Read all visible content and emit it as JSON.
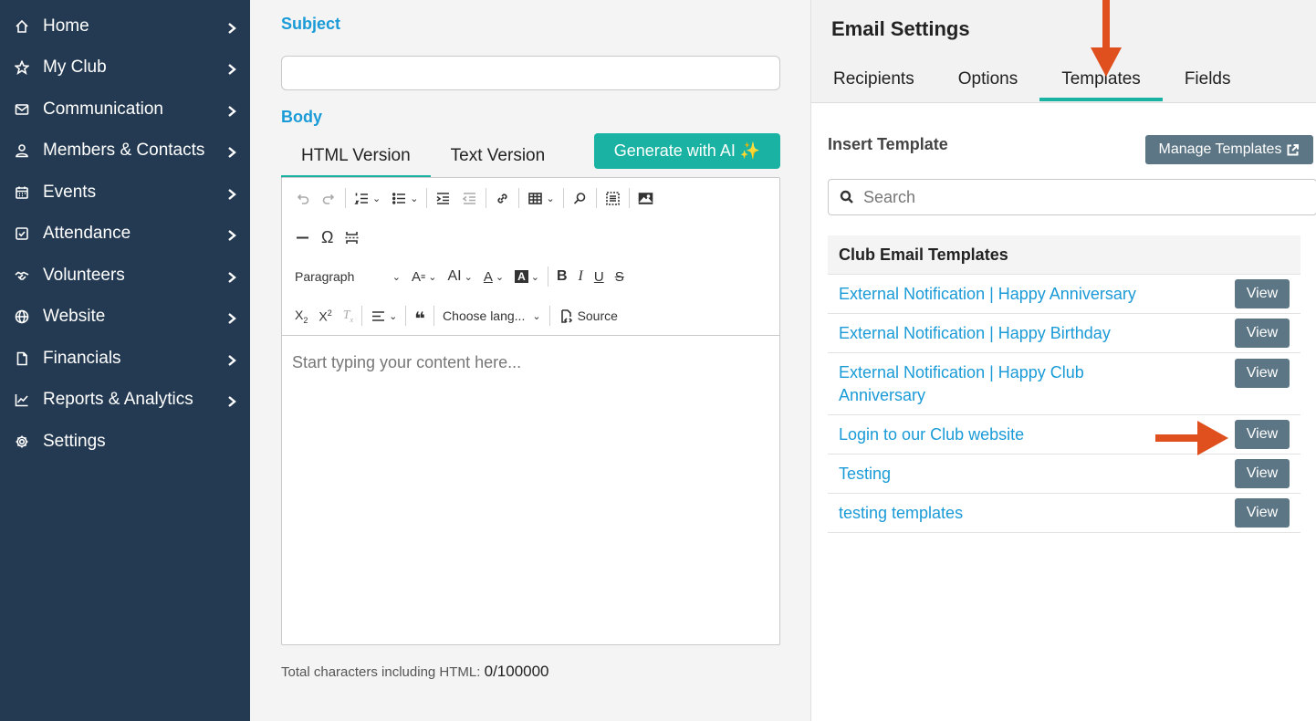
{
  "sidebar": {
    "items": [
      {
        "label": "Home",
        "icon": "home-icon"
      },
      {
        "label": "My Club",
        "icon": "star-icon"
      },
      {
        "label": "Communication",
        "icon": "mail-icon"
      },
      {
        "label": "Members & Contacts",
        "icon": "user-icon"
      },
      {
        "label": "Events",
        "icon": "calendar-icon"
      },
      {
        "label": "Attendance",
        "icon": "checkbox-icon"
      },
      {
        "label": "Volunteers",
        "icon": "handshake-icon"
      },
      {
        "label": "Website",
        "icon": "globe-icon"
      },
      {
        "label": "Financials",
        "icon": "document-icon"
      },
      {
        "label": "Reports & Analytics",
        "icon": "chart-icon"
      },
      {
        "label": "Settings",
        "icon": "gear-icon"
      }
    ]
  },
  "editor": {
    "subject_label": "Subject",
    "subject_value": "",
    "body_label": "Body",
    "tabs": [
      {
        "label": "HTML Version",
        "active": true
      },
      {
        "label": "Text Version",
        "active": false
      }
    ],
    "ai_button": "Generate with AI ✨",
    "toolbar": {
      "paragraph": "Paragraph",
      "language": "Choose lang...",
      "source": "Source"
    },
    "placeholder": "Start typing your content here...",
    "char_count_label": "Total characters including HTML:",
    "char_count_value": "0/100000"
  },
  "panel": {
    "title": "Email Settings",
    "tabs": [
      {
        "label": "Recipients",
        "active": false
      },
      {
        "label": "Options",
        "active": false
      },
      {
        "label": "Templates",
        "active": true
      },
      {
        "label": "Fields",
        "active": false
      }
    ],
    "insert_label": "Insert Template",
    "manage_button": "Manage Templates",
    "search_placeholder": "Search",
    "table_header": "Club Email Templates",
    "view_label": "View",
    "templates": [
      "External Notification | Happy Anniversary",
      "External Notification | Happy Birthday",
      "External Notification | Happy Club Anniversary",
      "Login to our Club website",
      "Testing",
      "testing templates"
    ]
  },
  "colors": {
    "sidebar_bg": "#243a52",
    "accent_teal": "#1ab3a3",
    "link_blue": "#1a9bd7",
    "button_slate": "#5c7686",
    "annotation_arrow": "#e0501e"
  }
}
